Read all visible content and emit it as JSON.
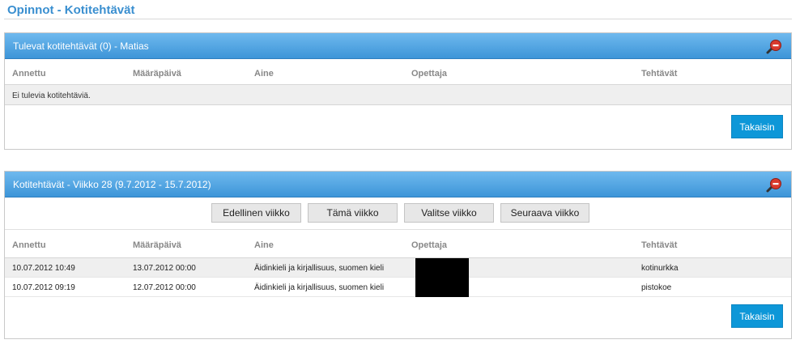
{
  "page": {
    "title": "Opinnot - Kotitehtävät"
  },
  "upcoming": {
    "header": "Tulevat kotitehtävät (0) - Matias",
    "columns": [
      "Annettu",
      "Määräpäivä",
      "Aine",
      "Opettaja",
      "Tehtävät"
    ],
    "empty_text": "Ei tulevia kotitehtäviä.",
    "back_label": "Takaisin"
  },
  "weekly": {
    "header": "Kotitehtävät - Viikko 28 (9.7.2012 - 15.7.2012)",
    "nav": {
      "prev": "Edellinen viikko",
      "current": "Tämä viikko",
      "choose": "Valitse viikko",
      "next": "Seuraava viikko"
    },
    "columns": [
      "Annettu",
      "Määräpäivä",
      "Aine",
      "Opettaja",
      "Tehtävät"
    ],
    "rows": [
      {
        "given": "10.07.2012 10:49",
        "due": "13.07.2012 00:00",
        "subject": "Äidinkieli ja kirjallisuus, suomen kieli",
        "task": "kotinurkka"
      },
      {
        "given": "10.07.2012 09:19",
        "due": "12.07.2012 00:00",
        "subject": "Äidinkieli ja kirjallisuus, suomen kieli",
        "task": "pistokoe"
      }
    ],
    "back_label": "Takaisin"
  }
}
